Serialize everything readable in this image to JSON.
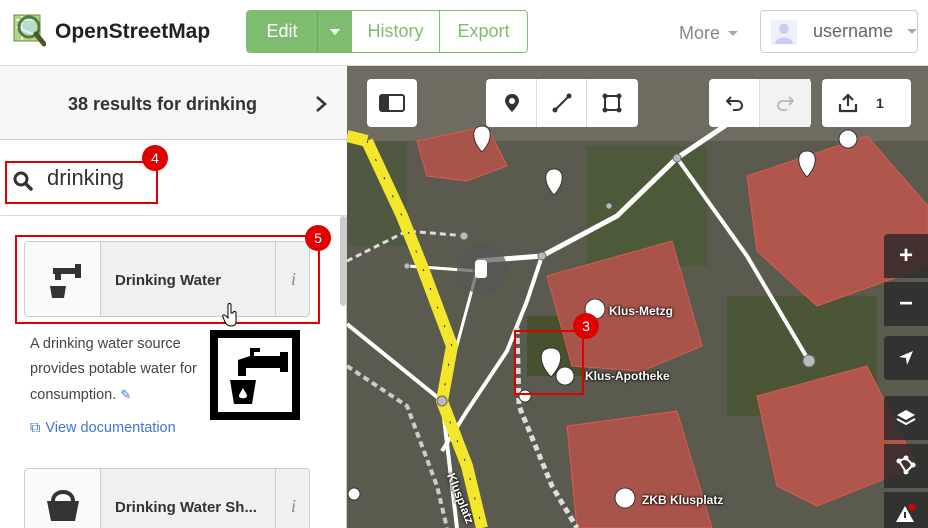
{
  "header": {
    "brand": "OpenStreetMap",
    "edit_label": "Edit",
    "history_label": "History",
    "export_label": "Export",
    "more_label": "More",
    "username": "username"
  },
  "sidebar": {
    "title": "38 results for drinking",
    "search_value": "drinking",
    "results": [
      {
        "label": "Drinking Water",
        "icon": "drinking-water-icon",
        "info": "i"
      },
      {
        "label": "Drinking Water Sh...",
        "icon": "shop-basket-icon",
        "info": "i"
      }
    ],
    "description": "A drinking water source provides potable water for consumption.",
    "doc_link": "View documentation"
  },
  "map": {
    "toolbar": {
      "changes_count": "1"
    },
    "labels": {
      "klus_metzg": "Klus-Metzg",
      "klus_apotheke": "Klus-Apotheke",
      "klusplatz": "Klusplatz",
      "zkb": "ZKB Klusplatz"
    }
  },
  "annotations": [
    "4",
    "5",
    "3"
  ],
  "colors": {
    "accent_green": "#7ebc6f",
    "annotation_red": "#e00000",
    "link_blue": "#3c78d8"
  }
}
